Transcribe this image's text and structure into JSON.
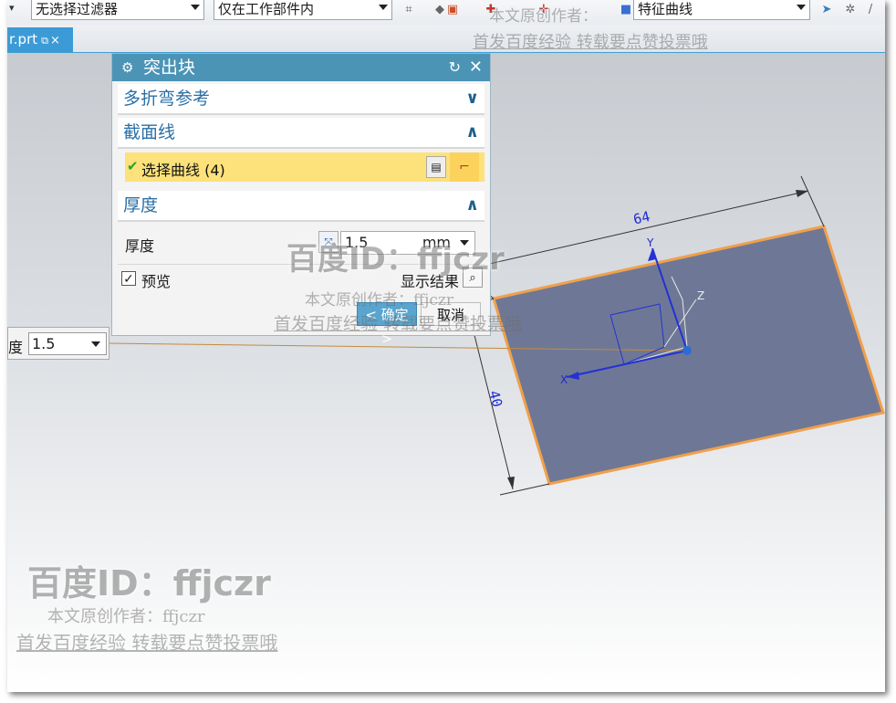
{
  "toolbar": {
    "filter_select": "无选择过滤器",
    "scope_select": "仅在工作部件内",
    "curve_rule_select": "特征曲线"
  },
  "tab": {
    "label": "r.prt",
    "pin": "⧉",
    "close": "×"
  },
  "dialog": {
    "title": "突出块",
    "sections": {
      "multi_bend_ref": "多折弯参考",
      "section_curve": "截面线",
      "thickness": "厚度"
    },
    "select_curve_label": "选择曲线 (4)",
    "thickness_label": "厚度",
    "thickness_value": "1.5",
    "thickness_unit": "mm",
    "preview_label": "预览",
    "show_result_label": "显示结果",
    "ok_label": "< 确定 >",
    "cancel_label": "取消"
  },
  "viewport_input": {
    "label": "度",
    "value": "1.5"
  },
  "dimensions": {
    "width": "64",
    "height": "40"
  },
  "axes": {
    "x": "X",
    "y": "Y",
    "z": "Z"
  },
  "watermark": {
    "id_line": "百度ID：ffjczr",
    "author_line": "本文原创作者：ffjczr",
    "publish_line": "首发百度经验 转载要点赞投票哦",
    "top_author_line": "本文原创作者：",
    "top_publish_line": "首发百度经验 转载要点赞投票哦"
  },
  "colors": {
    "plate_fill": "#6e7896",
    "plate_edge": "#f0a04b",
    "dialog_title": "#4b94b6",
    "tab_active": "#3c9bd6",
    "selection_highlight": "#fde17a"
  }
}
